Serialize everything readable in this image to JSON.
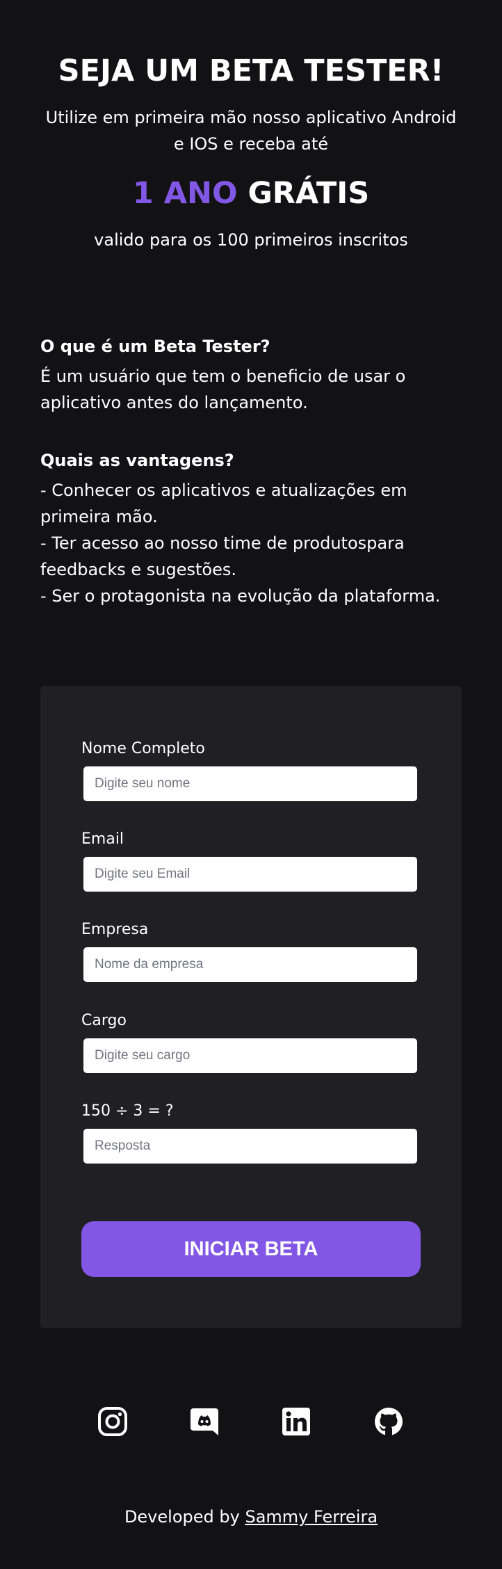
{
  "hero": {
    "title": "SEJA UM BETA TESTER!",
    "intro": "Utilize em primeira mão nosso aplicativo Android e IOS e receba até",
    "offer_highlight": "1 ANO",
    "offer_rest": "GRÁTIS",
    "valid_note": "valido para os 100 primeiros inscritos"
  },
  "info": {
    "q1": "O que é um Beta Tester?",
    "a1": "É um usuário que tem o beneficio de usar o aplicativo antes do lançamento.",
    "q2": "Quais as vantagens?",
    "benefits": [
      "- Conhecer os aplicativos e atualizações em primeira mão.",
      "- Ter acesso ao nosso time de produtospara feedbacks e sugestões.",
      "- Ser o protagonista na evolução da plataforma."
    ]
  },
  "form": {
    "fields": [
      {
        "label": "Nome Completo",
        "placeholder": "Digite seu nome"
      },
      {
        "label": "Email",
        "placeholder": "Digite seu Email"
      },
      {
        "label": "Empresa",
        "placeholder": "Nome da empresa"
      },
      {
        "label": "Cargo",
        "placeholder": "Digite seu cargo"
      },
      {
        "label": "150 ÷ 3 = ?",
        "placeholder": "Resposta"
      }
    ],
    "submit_label": "INICIAR BETA"
  },
  "socials": [
    "instagram-icon",
    "discord-icon",
    "linkedin-icon",
    "github-icon"
  ],
  "footer": {
    "prefix": "Developed by",
    "author": "Sammy Ferreira"
  },
  "colors": {
    "background": "#121214",
    "card": "#202024",
    "accent": "#8257e5",
    "text": "#ffffff",
    "placeholder": "#737380"
  }
}
